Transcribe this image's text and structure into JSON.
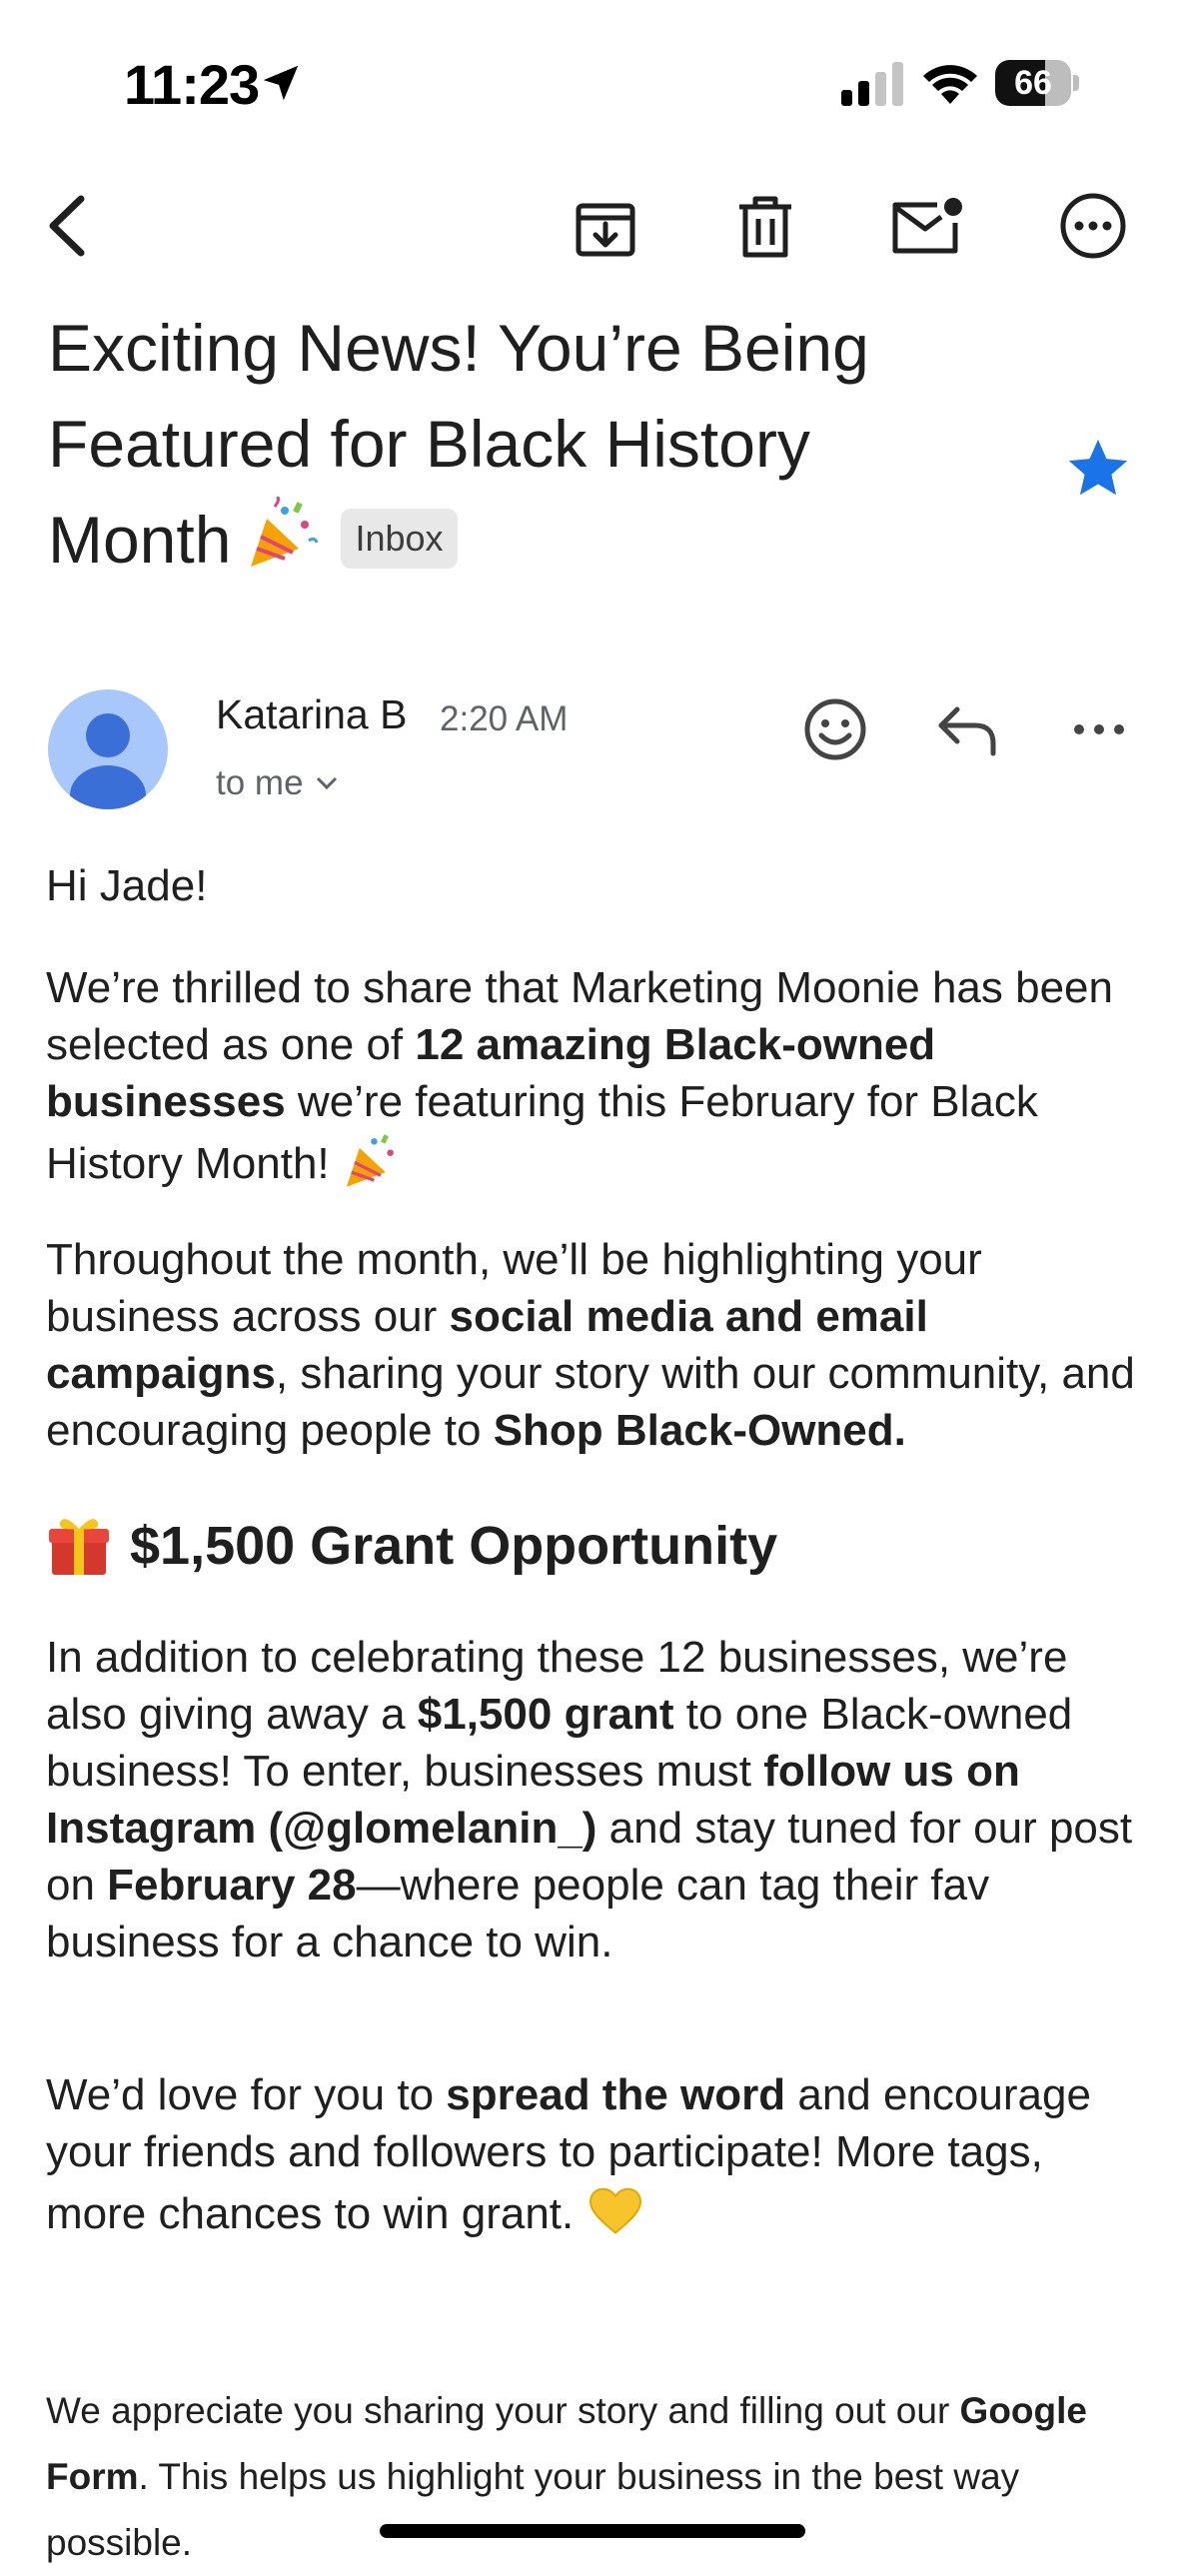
{
  "status_bar": {
    "time": "11:23",
    "battery_level": "66",
    "battery_fraction": 0.66
  },
  "toolbar": {
    "icons": [
      "back-arrow-icon",
      "archive-icon",
      "trash-icon",
      "mark-unread-icon",
      "more-options-icon"
    ]
  },
  "email": {
    "subject_line1": "Exciting News! You’re Being",
    "subject_line2": "Featured for Black History",
    "subject_line3": "Month",
    "label": "Inbox",
    "starred": true,
    "star_color": "#1a73e8",
    "sender_name": "Katarina B",
    "time": "2:20 AM",
    "recipient": "to me",
    "avatar_color": "#a8c7fa"
  },
  "body": {
    "greeting": "Hi Jade!",
    "p1_a": "We’re thrilled to share that Marketing Moonie has been selected as one of ",
    "p1_b": "12 amazing Black-owned businesses",
    "p1_c": " we’re featuring this February for Black History Month! ",
    "p2_a": "Throughout the month, we’ll be highlighting your business across our ",
    "p2_b": "social media and email campaigns",
    "p2_c": ", sharing your story with our community, and encouraging people to ",
    "p2_d": "Shop Black-Owned.",
    "heading": "$1,500 Grant Opportunity",
    "p3_a": "In addition to celebrating these 12 businesses, we’re also giving away a ",
    "p3_b": "$1,500 grant",
    "p3_c": " to one Black-owned business! To enter, businesses must ",
    "p3_d": "follow us on Instagram (@glomelanin_)",
    "p3_e": " and stay tuned for our post on ",
    "p3_f": "February 28",
    "p3_g": "—where people can tag their fav business for a chance to win.",
    "p4_a": "We’d love for you to ",
    "p4_b": "spread the word",
    "p4_c": " and encourage your friends and followers to participate!  More tags, more chances to win grant. ",
    "p5_a": "We appreciate you sharing your story and filling out our ",
    "p5_b": "Google Form",
    "p5_c": ". This helps us highlight your business in the best way possible."
  }
}
